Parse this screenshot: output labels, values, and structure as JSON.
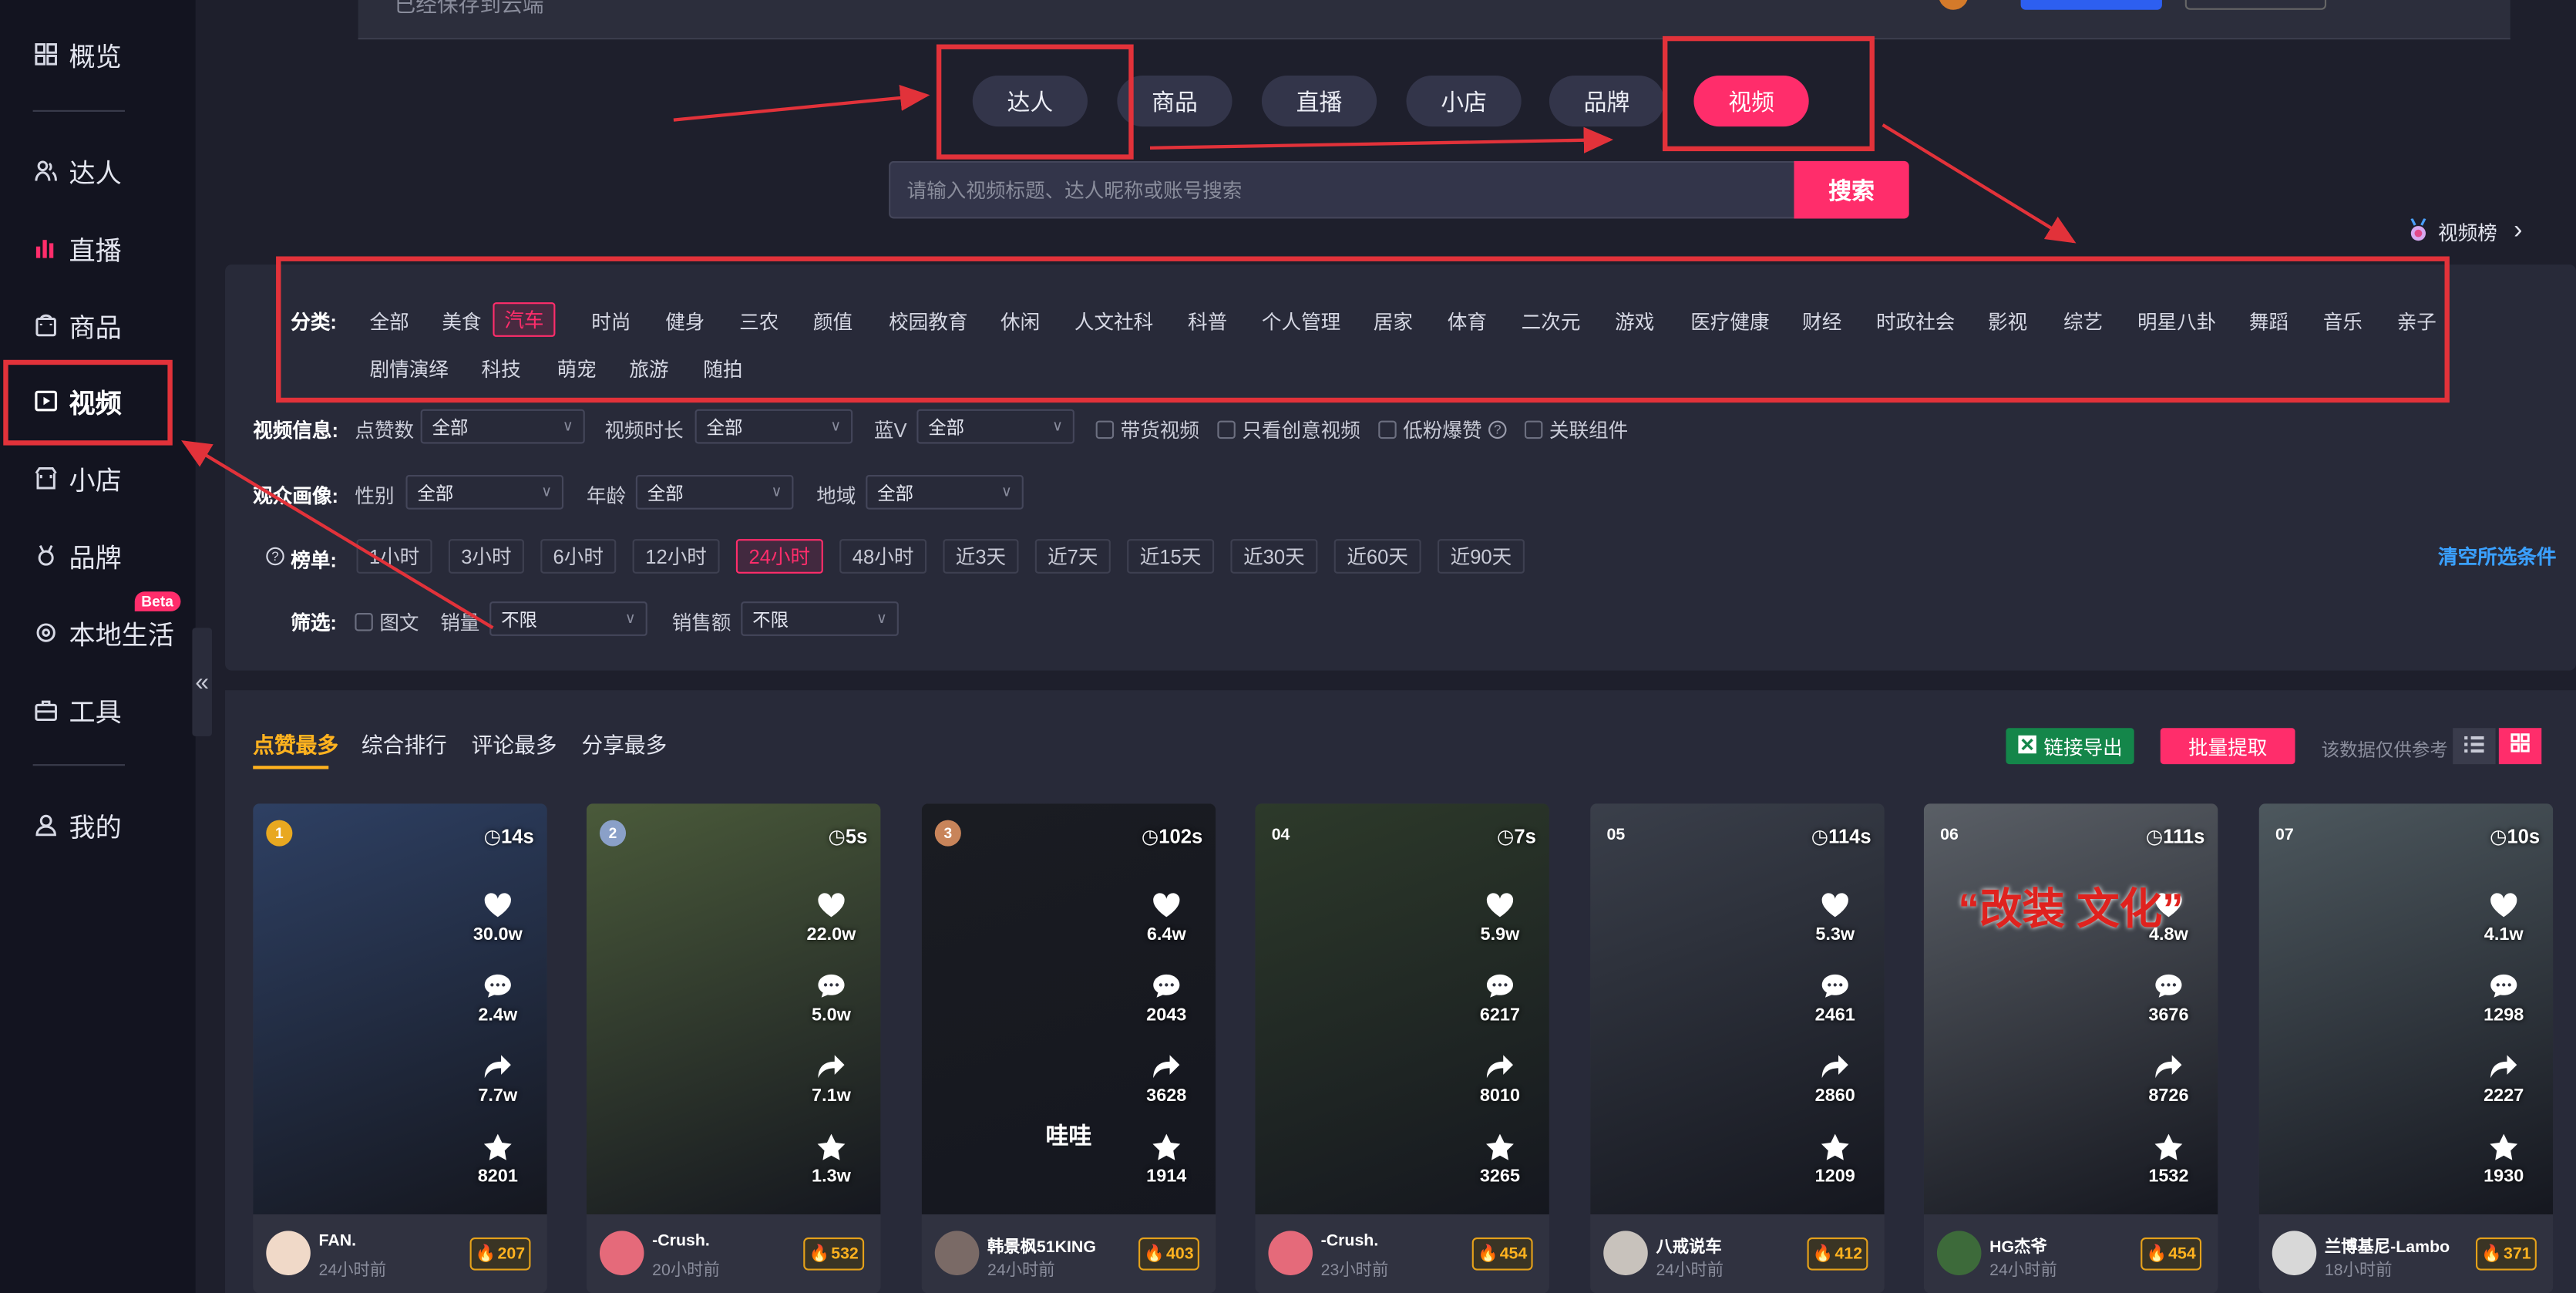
{
  "topbar": {
    "saved_text": "已经保存到云端"
  },
  "sidebar": {
    "items": [
      {
        "label": "概览",
        "icon": "grid-icon"
      },
      {
        "label": "达人",
        "icon": "people-icon"
      },
      {
        "label": "直播",
        "icon": "bar-chart-icon"
      },
      {
        "label": "商品",
        "icon": "bag-icon"
      },
      {
        "label": "视频",
        "icon": "play-icon",
        "active": true
      },
      {
        "label": "小店",
        "icon": "store-icon"
      },
      {
        "label": "品牌",
        "icon": "medal-icon"
      },
      {
        "label": "本地生活",
        "icon": "pin-icon",
        "badge": "Beta"
      },
      {
        "label": "工具",
        "icon": "toolbox-icon"
      },
      {
        "label": "我的",
        "icon": "user-icon"
      }
    ],
    "collapse_glyph": "«"
  },
  "category_pills": [
    {
      "label": "达人"
    },
    {
      "label": "商品"
    },
    {
      "label": "直播"
    },
    {
      "label": "小店"
    },
    {
      "label": "品牌"
    },
    {
      "label": "视频",
      "active": true
    }
  ],
  "search": {
    "placeholder": "请输入视频标题、达人昵称或账号搜索",
    "button_label": "搜索"
  },
  "rank_link": {
    "label": "视频榜",
    "arrow": "›"
  },
  "filters": {
    "category": {
      "label": "分类:",
      "items": [
        "全部",
        "美食",
        "汽车",
        "时尚",
        "健身",
        "三农",
        "颜值",
        "校园教育",
        "休闲",
        "人文社科",
        "科普",
        "个人管理",
        "居家",
        "体育",
        "二次元",
        "游戏",
        "医疗健康",
        "财经",
        "时政社会",
        "影视",
        "综艺",
        "明星八卦",
        "舞蹈",
        "音乐",
        "亲子",
        "剧情演绎",
        "科技",
        "萌宠",
        "旅游",
        "随拍"
      ],
      "active": "汽车"
    },
    "video_info": {
      "label": "视频信息:",
      "likes_label": "点赞数",
      "likes_value": "全部",
      "duration_label": "视频时长",
      "duration_value": "全部",
      "bluev_label": "蓝V",
      "bluev_value": "全部",
      "checks": [
        "带货视频",
        "只看创意视频",
        "低粉爆赞",
        "关联组件"
      ]
    },
    "audience": {
      "label": "观众画像:",
      "gender_label": "性别",
      "gender_value": "全部",
      "age_label": "年龄",
      "age_value": "全部",
      "region_label": "地域",
      "region_value": "全部"
    },
    "ranking": {
      "label": "榜单:",
      "items": [
        "1小时",
        "3小时",
        "6小时",
        "12小时",
        "24小时",
        "48小时",
        "近3天",
        "近7天",
        "近15天",
        "近30天",
        "近60天",
        "近90天"
      ],
      "active": "24小时"
    },
    "screen": {
      "label": "筛选:",
      "check_label": "图文",
      "sales_label": "销量",
      "sales_value": "不限",
      "revenue_label": "销售额",
      "revenue_value": "不限"
    },
    "clear_label": "清空所选条件"
  },
  "sort_tabs": [
    {
      "label": "点赞最多",
      "active": true
    },
    {
      "label": "综合排行"
    },
    {
      "label": "评论最多"
    },
    {
      "label": "分享最多"
    }
  ],
  "actions": {
    "export_label": "链接导出",
    "batch_label": "批量提取",
    "note": "该数据仅供参考"
  },
  "videos": [
    {
      "rank": "1",
      "duration": "14s",
      "likes": "30.0w",
      "comments": "2.4w",
      "shares": "7.7w",
      "favorites": "8201",
      "author": "FAN.",
      "time": "24小时前",
      "heat": "207",
      "bg": "#2e4063",
      "avatar_color": "#f0d9c8"
    },
    {
      "rank": "2",
      "duration": "5s",
      "likes": "22.0w",
      "comments": "5.0w",
      "shares": "7.1w",
      "favorites": "1.3w",
      "author": "-Crush.",
      "time": "20小时前",
      "heat": "532",
      "bg": "#4a5a3a",
      "avatar_color": "#e56a7a"
    },
    {
      "rank": "3",
      "duration": "102s",
      "likes": "6.4w",
      "comments": "2043",
      "shares": "3628",
      "favorites": "1914",
      "author": "韩景枫51KING",
      "time": "24小时前",
      "heat": "403",
      "bg": "#1a1c22",
      "avatar_color": "#7a6a66",
      "overlay": "哇哇"
    },
    {
      "rank": "04",
      "duration": "7s",
      "likes": "5.9w",
      "comments": "6217",
      "shares": "8010",
      "favorites": "3265",
      "author": "-Crush.",
      "time": "23小时前",
      "heat": "454",
      "bg": "#2d3a2a",
      "avatar_color": "#e56a7a"
    },
    {
      "rank": "05",
      "duration": "114s",
      "likes": "5.3w",
      "comments": "2461",
      "shares": "2860",
      "favorites": "1209",
      "author": "八戒说车",
      "time": "24小时前",
      "heat": "412",
      "bg": "#3a3f4a",
      "avatar_color": "#c8c2bc"
    },
    {
      "rank": "06",
      "duration": "111s",
      "likes": "4.8w",
      "comments": "3676",
      "shares": "8726",
      "favorites": "1532",
      "author": "HG杰爷",
      "time": "24小时前",
      "heat": "454",
      "bg": "#5a5f66",
      "avatar_color": "#3d6a3a",
      "overlay": "“改装 文化”"
    },
    {
      "rank": "07",
      "duration": "10s",
      "likes": "4.1w",
      "comments": "1298",
      "shares": "2227",
      "favorites": "1930",
      "author": "兰博基尼-Lambo",
      "time": "18小时前",
      "heat": "371",
      "bg": "#4d585e",
      "avatar_color": "#d8d8d8"
    }
  ],
  "colors": {
    "accent": "#ff2d6b",
    "gold": "#ffb21f",
    "annotation": "#e2323a",
    "link": "#3aa0ff"
  }
}
